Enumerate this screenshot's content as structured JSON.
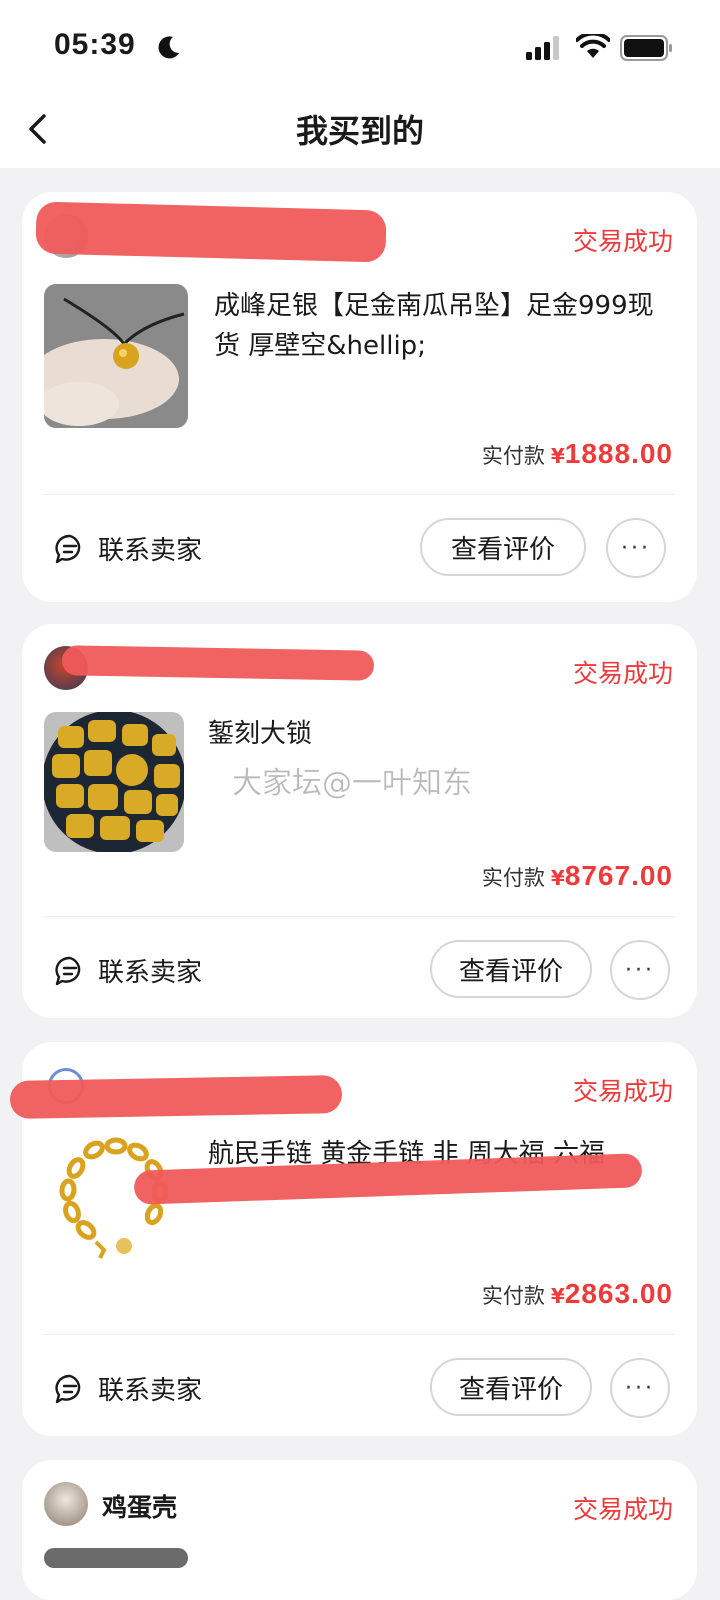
{
  "status_bar": {
    "time": "05:39"
  },
  "nav": {
    "title": "我买到的"
  },
  "orders": [
    {
      "seller": "",
      "status": "交易成功",
      "title": "成峰足银【足金南瓜吊坠】足金999现货 厚壁空&hellip;",
      "price_label": "实付款",
      "currency": "¥",
      "price": "1888.00",
      "contact_label": "联系卖家",
      "review_label": "查看评价",
      "more_label": "···"
    },
    {
      "seller": "",
      "status": "交易成功",
      "title": "錾刻大锁",
      "price_label": "实付款",
      "currency": "¥",
      "price": "8767.00",
      "contact_label": "联系卖家",
      "review_label": "查看评价",
      "more_label": "···"
    },
    {
      "seller": "",
      "status": "交易成功",
      "title": "航民手链 黄金手链 非 周大福 六福",
      "price_label": "实付款",
      "currency": "¥",
      "price": "2863.00",
      "contact_label": "联系卖家",
      "review_label": "查看评价",
      "more_label": "···"
    },
    {
      "seller": "鸡蛋壳",
      "status": "交易成功"
    }
  ],
  "watermark": "大家坛@一叶知东",
  "colors": {
    "accent": "#ee3a3a",
    "background": "#f2f2f4"
  }
}
